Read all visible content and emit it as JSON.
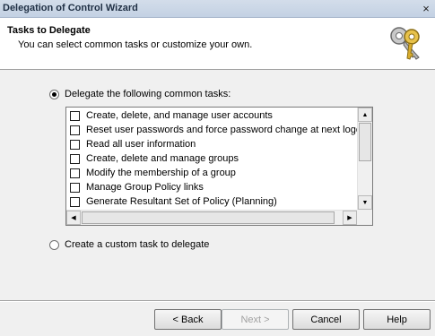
{
  "window": {
    "title": "Delegation of Control Wizard",
    "close_glyph": "×"
  },
  "header": {
    "title": "Tasks to Delegate",
    "subtitle": "You can select common tasks or customize your own.",
    "icon": "keys-icon"
  },
  "options": {
    "common": {
      "label": "Delegate the following common tasks:",
      "selected": true
    },
    "custom": {
      "label": "Create a custom task to delegate",
      "selected": false
    }
  },
  "tasks": [
    {
      "label": "Create, delete, and manage user accounts",
      "checked": false
    },
    {
      "label": "Reset user passwords and force password change at next logon",
      "checked": false
    },
    {
      "label": "Read all user information",
      "checked": false
    },
    {
      "label": "Create, delete and manage groups",
      "checked": false
    },
    {
      "label": "Modify the membership of a group",
      "checked": false
    },
    {
      "label": "Manage Group Policy links",
      "checked": false
    },
    {
      "label": "Generate Resultant Set of Policy (Planning)",
      "checked": false
    }
  ],
  "scroll": {
    "up": "▲",
    "down": "▼",
    "left": "◀",
    "right": "▶"
  },
  "buttons": {
    "back": "< Back",
    "next": "Next >",
    "cancel": "Cancel",
    "help": "Help"
  }
}
